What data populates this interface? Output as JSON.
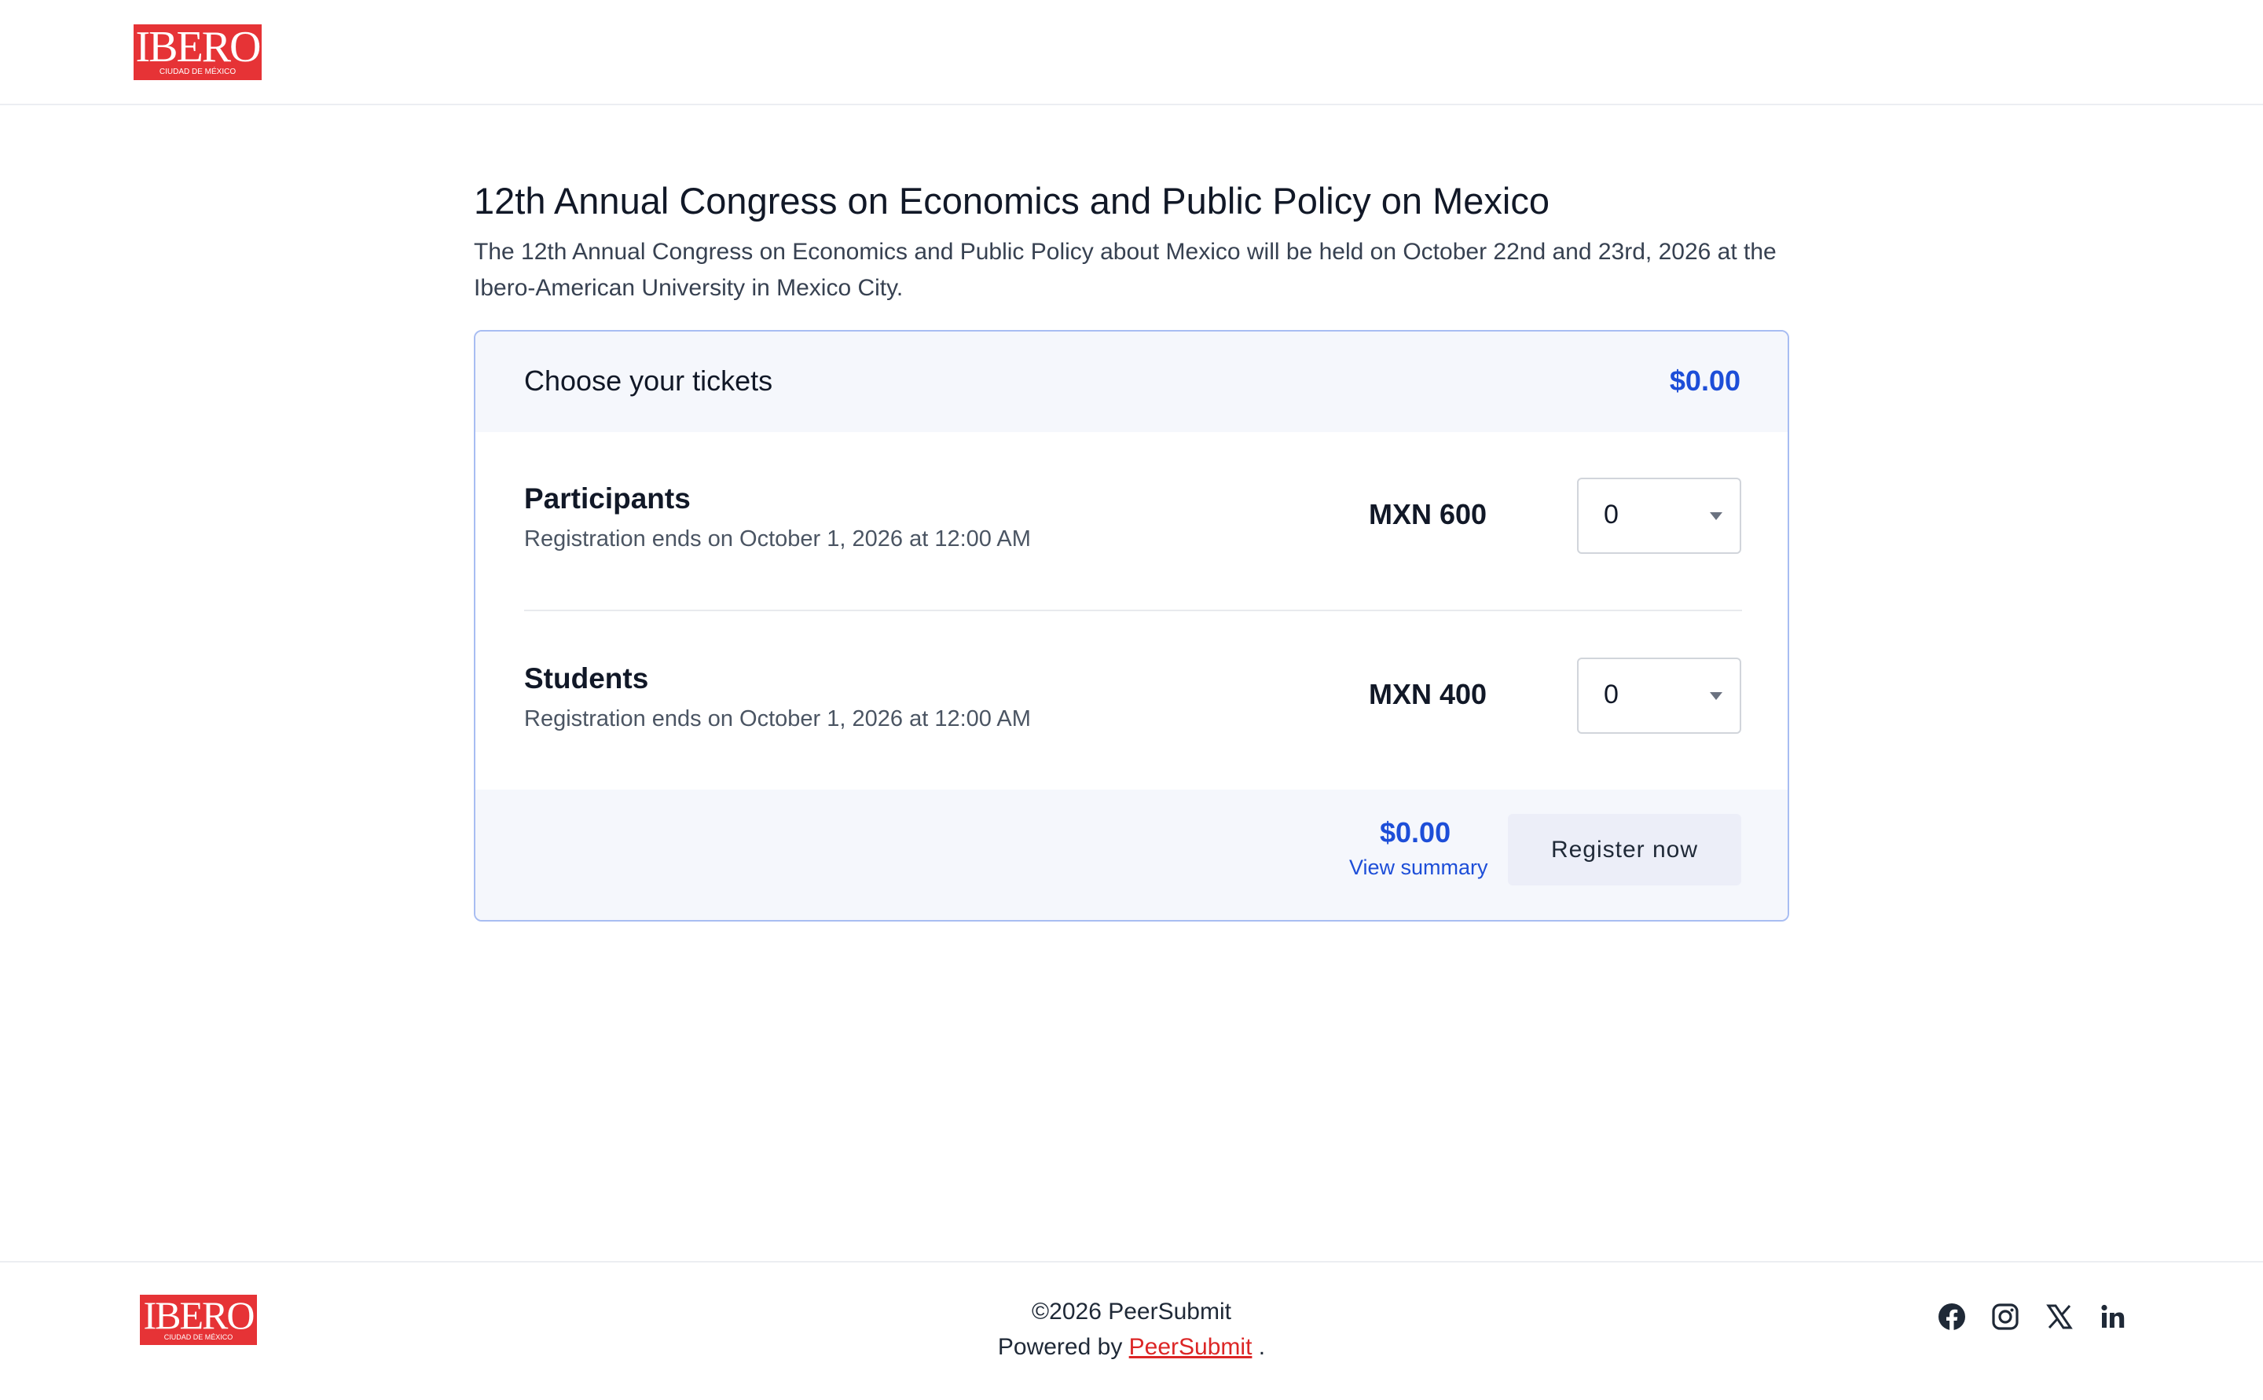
{
  "header": {
    "logo": {
      "text": "IBERO",
      "subtitle": "CIUDAD DE MÉXICO"
    }
  },
  "event": {
    "title": "12th Annual Congress on Economics and Public Policy on Mexico",
    "description": "The 12th Annual Congress on Economics and Public Policy about Mexico will be held on October 22nd and 23rd, 2026 at the Ibero-American University in Mexico City."
  },
  "tickets": {
    "heading": "Choose your tickets",
    "total": "$0.00",
    "items": [
      {
        "name": "Participants",
        "deadline": "Registration ends on October 1, 2026 at 12:00 AM",
        "price": "MXN 600",
        "quantity": "0"
      },
      {
        "name": "Students",
        "deadline": "Registration ends on October 1, 2026 at 12:00 AM",
        "price": "MXN 400",
        "quantity": "0"
      }
    ],
    "footer": {
      "total": "$0.00",
      "view_summary_label": "View summary",
      "register_label": "Register now"
    }
  },
  "footer": {
    "logo": {
      "text": "IBERO",
      "subtitle": "CIUDAD DE MÉXICO"
    },
    "copyright": "©2026 PeerSubmit",
    "powered_prefix": "Powered by",
    "powered_link": "PeerSubmit",
    "powered_suffix": ".",
    "social_icons": [
      "facebook-icon",
      "instagram-icon",
      "x-icon",
      "linkedin-icon"
    ]
  },
  "colors": {
    "brand_red": "#e63336",
    "accent_blue": "#1d4ed8",
    "card_border": "#a8bdf2",
    "panel_bg": "#f5f7fc",
    "button_bg": "#eceef8"
  }
}
